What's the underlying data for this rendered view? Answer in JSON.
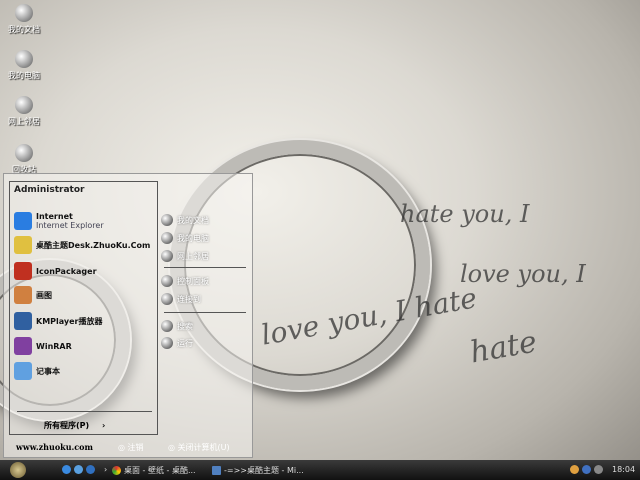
{
  "desktop_icons": [
    {
      "label": "我的文档"
    },
    {
      "label": "我的电脑"
    },
    {
      "label": "网上邻居"
    },
    {
      "label": "回收站"
    }
  ],
  "wallpaper_text": [
    "hate you, I",
    "love you, I hate",
    "love you, I",
    "hate"
  ],
  "start_menu": {
    "user": "Administrator",
    "programs": [
      {
        "label": "Internet",
        "sub": "Internet Explorer",
        "color": "#2a7de1"
      },
      {
        "label": "桌酷主题Desk.ZhuoKu.Com",
        "color": "#e0c040"
      },
      {
        "label": "IconPackager",
        "color": "#c03020"
      },
      {
        "label": "画图",
        "color": "#d08040"
      },
      {
        "label": "KMPlayer播放器",
        "color": "#3060a0"
      },
      {
        "label": "WinRAR",
        "color": "#8040a0"
      },
      {
        "label": "记事本",
        "color": "#60a0e0"
      }
    ],
    "all_programs": "所有程序(P)",
    "right": [
      {
        "label": "我的文档"
      },
      {
        "label": "我的电脑"
      },
      {
        "label": "网上邻居"
      },
      {
        "label": "控制面板"
      },
      {
        "label": "连接到"
      },
      {
        "label": "搜索"
      },
      {
        "label": "运行"
      }
    ],
    "website": "www.zhuoku.com",
    "logoff": "注销",
    "shutdown": "关闭计算机(U)"
  },
  "taskbar": {
    "tasks": [
      {
        "label": "桌面 - 壁纸 - 桌酷..."
      },
      {
        "label": "-=>>桌酷主题 - Mi..."
      }
    ],
    "clock": "18:04",
    "chevron": "›"
  }
}
